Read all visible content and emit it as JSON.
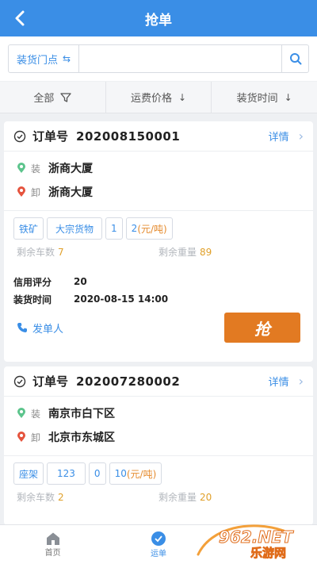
{
  "header": {
    "title": "抢单"
  },
  "search": {
    "store_label": "装货门点",
    "placeholder": ""
  },
  "filters": [
    {
      "label": "全部"
    },
    {
      "label": "运费价格"
    },
    {
      "label": "装货时间"
    }
  ],
  "orders": [
    {
      "order_label": "订单号",
      "order_no": "202008150001",
      "detail_label": "详情",
      "load_tag": "装",
      "load_place": "浙商大厦",
      "unload_tag": "卸",
      "unload_place": "浙商大厦",
      "chips": [
        "铁矿",
        "大宗货物",
        "1",
        "2"
      ],
      "price_unit": "(元/吨)",
      "remain_cars_label": "剩余车数",
      "remain_cars": "7",
      "remain_weight_label": "剩余重量",
      "remain_weight": "89",
      "credit_label": "信用评分",
      "credit_value": "20",
      "load_time_label": "装货时间",
      "load_time_value": "2020-08-15 14:00",
      "sender_label": "发单人",
      "grab_label": "抢"
    },
    {
      "order_label": "订单号",
      "order_no": "202007280002",
      "detail_label": "详情",
      "load_tag": "装",
      "load_place": "南京市白下区",
      "unload_tag": "卸",
      "unload_place": "北京市东城区",
      "chips": [
        "座架",
        "123",
        "0",
        "10"
      ],
      "price_unit": "(元/吨)",
      "remain_cars_label": "剩余车数",
      "remain_cars": "2",
      "remain_weight_label": "剩余重量",
      "remain_weight": "20"
    }
  ],
  "tabbar": [
    {
      "label": "首页",
      "icon": "home-icon"
    },
    {
      "label": "运单",
      "icon": "waybill-icon"
    }
  ],
  "watermark": {
    "text_top": "962.NET",
    "text_bottom": "乐游网"
  },
  "colors": {
    "primary": "#3a8ee6",
    "accent": "#e27a22",
    "highlight": "#e0a02a"
  }
}
